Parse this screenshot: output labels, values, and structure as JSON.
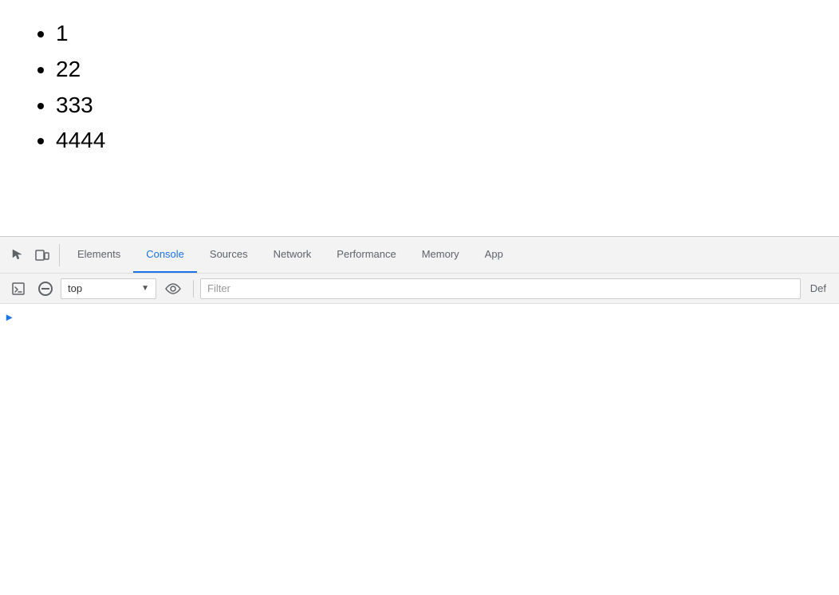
{
  "page": {
    "list_items": [
      "1",
      "22",
      "333",
      "4444"
    ]
  },
  "devtools": {
    "tabs": [
      {
        "label": "Elements",
        "active": false
      },
      {
        "label": "Console",
        "active": true
      },
      {
        "label": "Sources",
        "active": false
      },
      {
        "label": "Network",
        "active": false
      },
      {
        "label": "Performance",
        "active": false
      },
      {
        "label": "Memory",
        "active": false
      },
      {
        "label": "App",
        "active": false
      }
    ],
    "secondary": {
      "context": "top",
      "filter_placeholder": "Filter",
      "default_label": "Def"
    }
  }
}
